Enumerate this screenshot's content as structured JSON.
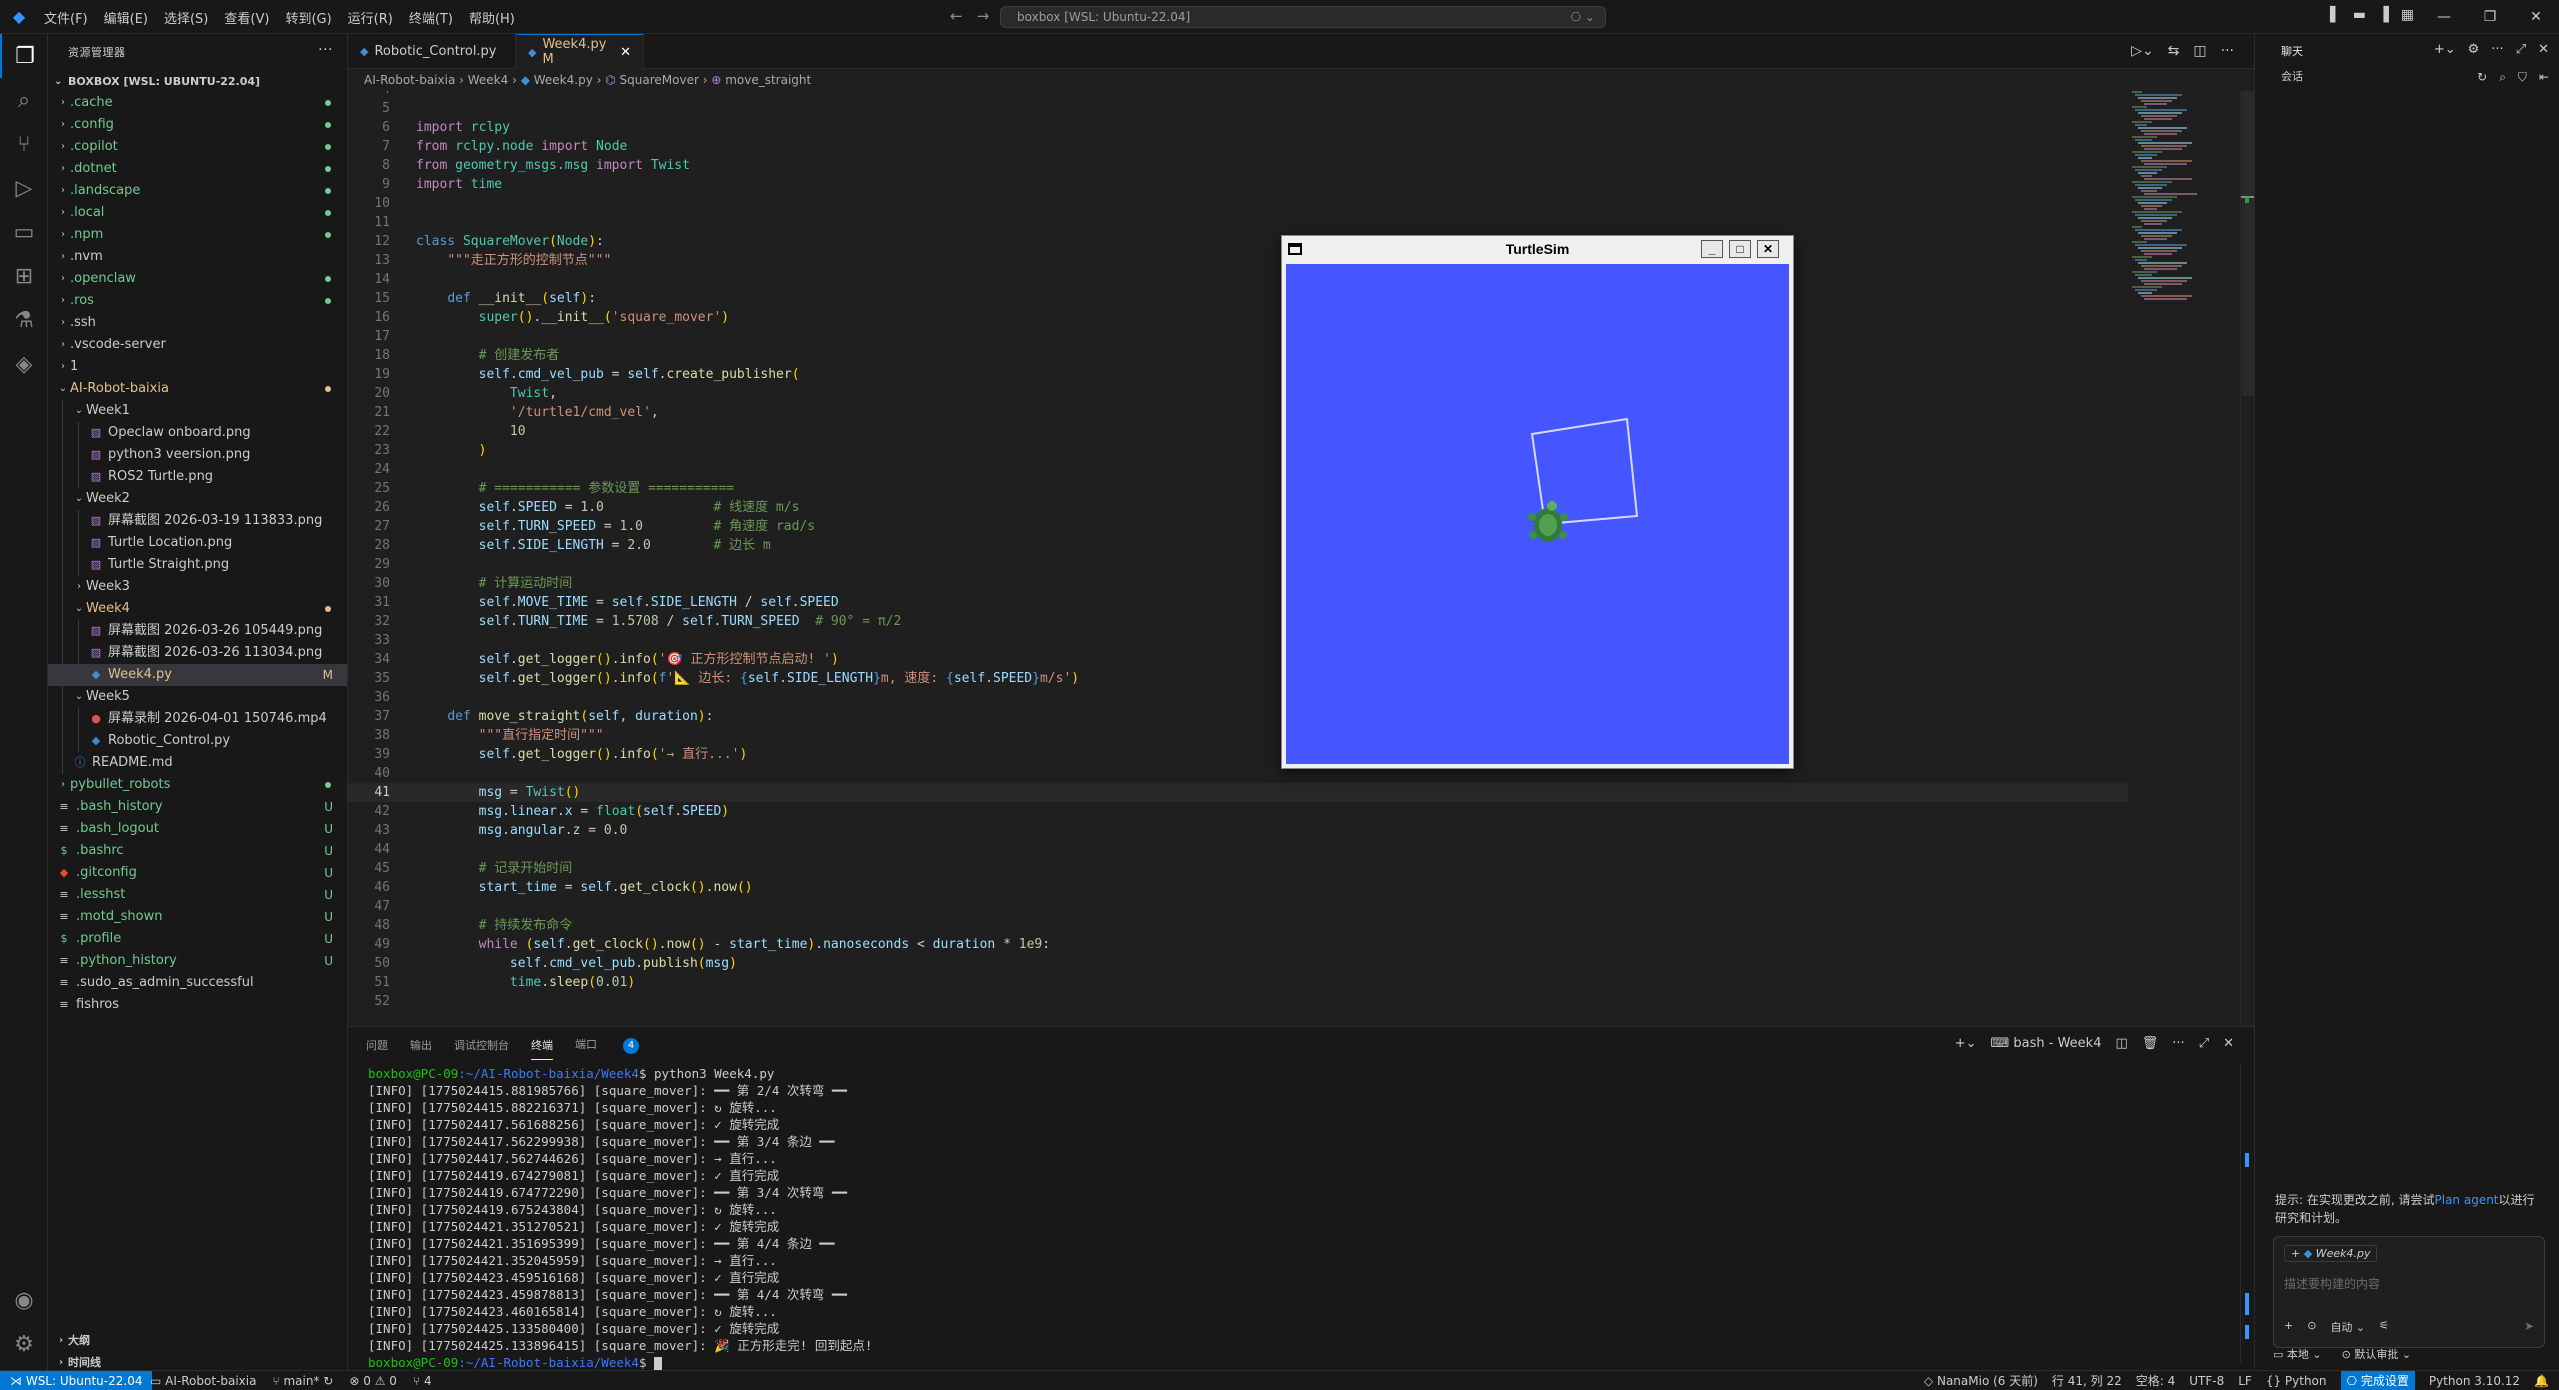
{
  "titlebar": {
    "menu": [
      "文件(F)",
      "编辑(E)",
      "选择(S)",
      "查看(V)",
      "转到(G)",
      "运行(R)",
      "终端(T)",
      "帮助(H)"
    ],
    "command_center": "boxbox [WSL: Ubuntu-22.04]"
  },
  "sidebar": {
    "title": "资源管理器",
    "root": "BOXBOX [WSL: UBUNTU-22.04]",
    "items": [
      {
        "label": ".cache",
        "depth": 0,
        "kind": "folder",
        "open": false,
        "color": "#73c991",
        "dot": true
      },
      {
        "label": ".config",
        "depth": 0,
        "kind": "folder",
        "open": false,
        "color": "#73c991",
        "dot": true
      },
      {
        "label": ".copilot",
        "depth": 0,
        "kind": "folder",
        "open": false,
        "color": "#73c991",
        "dot": true
      },
      {
        "label": ".dotnet",
        "depth": 0,
        "kind": "folder",
        "open": false,
        "color": "#73c991",
        "dot": true
      },
      {
        "label": ".landscape",
        "depth": 0,
        "kind": "folder",
        "open": false,
        "color": "#73c991",
        "dot": true
      },
      {
        "label": ".local",
        "depth": 0,
        "kind": "folder",
        "open": false,
        "color": "#73c991",
        "dot": true
      },
      {
        "label": ".npm",
        "depth": 0,
        "kind": "folder",
        "open": false,
        "color": "#73c991",
        "dot": true
      },
      {
        "label": ".nvm",
        "depth": 0,
        "kind": "folder",
        "open": false,
        "color": "#cccccc",
        "dot": false
      },
      {
        "label": ".openclaw",
        "depth": 0,
        "kind": "folder",
        "open": false,
        "color": "#73c991",
        "dot": true
      },
      {
        "label": ".ros",
        "depth": 0,
        "kind": "folder",
        "open": false,
        "color": "#73c991",
        "dot": true
      },
      {
        "label": ".ssh",
        "depth": 0,
        "kind": "folder",
        "open": false,
        "color": "#cccccc",
        "dot": false
      },
      {
        "label": ".vscode-server",
        "depth": 0,
        "kind": "folder",
        "open": false,
        "color": "#cccccc",
        "dot": false
      },
      {
        "label": "1",
        "depth": 0,
        "kind": "folder",
        "open": false,
        "color": "#cccccc",
        "dot": false
      },
      {
        "label": "AI-Robot-baixia",
        "depth": 0,
        "kind": "folder",
        "open": true,
        "color": "#e2c08d",
        "dot": true,
        "dotcolor": "#e2c08d"
      },
      {
        "label": "Week1",
        "depth": 1,
        "kind": "folder",
        "open": true,
        "color": "#cccccc",
        "dot": false
      },
      {
        "label": "Opeclaw onboard.png",
        "depth": 2,
        "kind": "image",
        "color": "#cccccc",
        "dot": false
      },
      {
        "label": "python3 veersion.png",
        "depth": 2,
        "kind": "image",
        "color": "#cccccc",
        "dot": false
      },
      {
        "label": "ROS2 Turtle.png",
        "depth": 2,
        "kind": "image",
        "color": "#cccccc",
        "dot": false
      },
      {
        "label": "Week2",
        "depth": 1,
        "kind": "folder",
        "open": true,
        "color": "#cccccc",
        "dot": false
      },
      {
        "label": "屏幕截图 2026-03-19 113833.png",
        "depth": 2,
        "kind": "image",
        "color": "#cccccc",
        "dot": false
      },
      {
        "label": "Turtle Location.png",
        "depth": 2,
        "kind": "image",
        "color": "#cccccc",
        "dot": false
      },
      {
        "label": "Turtle Straight.png",
        "depth": 2,
        "kind": "image",
        "color": "#cccccc",
        "dot": false
      },
      {
        "label": "Week3",
        "depth": 1,
        "kind": "folder",
        "open": false,
        "color": "#cccccc",
        "dot": false
      },
      {
        "label": "Week4",
        "depth": 1,
        "kind": "folder",
        "open": true,
        "color": "#e2c08d",
        "dot": true,
        "dotcolor": "#e2c08d"
      },
      {
        "label": "屏幕截图 2026-03-26 105449.png",
        "depth": 2,
        "kind": "image",
        "color": "#cccccc",
        "dot": false
      },
      {
        "label": "屏幕截图 2026-03-26 113034.png",
        "depth": 2,
        "kind": "image",
        "color": "#cccccc",
        "dot": false
      },
      {
        "label": "Week4.py",
        "depth": 2,
        "kind": "python",
        "color": "#e2c08d",
        "badge": "M",
        "selected": true
      },
      {
        "label": "Week5",
        "depth": 1,
        "kind": "folder",
        "open": true,
        "color": "#cccccc",
        "dot": false
      },
      {
        "label": "屏幕录制 2026-04-01 150746.mp4",
        "depth": 2,
        "kind": "video",
        "color": "#cccccc",
        "dot": false
      },
      {
        "label": "Robotic_Control.py",
        "depth": 2,
        "kind": "python",
        "color": "#cccccc",
        "dot": false
      },
      {
        "label": "README.md",
        "depth": 1,
        "kind": "info",
        "color": "#cccccc",
        "dot": false
      },
      {
        "label": "pybullet_robots",
        "depth": 0,
        "kind": "folder",
        "open": false,
        "color": "#73c991",
        "dot": true
      },
      {
        "label": ".bash_history",
        "depth": 0,
        "kind": "file",
        "color": "#73c991",
        "badge": "U"
      },
      {
        "label": ".bash_logout",
        "depth": 0,
        "kind": "file",
        "color": "#73c991",
        "badge": "U"
      },
      {
        "label": ".bashrc",
        "depth": 0,
        "kind": "dollar",
        "color": "#73c991",
        "badge": "U"
      },
      {
        "label": ".gitconfig",
        "depth": 0,
        "kind": "git",
        "color": "#73c991",
        "badge": "U"
      },
      {
        "label": ".lesshst",
        "depth": 0,
        "kind": "file",
        "color": "#73c991",
        "badge": "U"
      },
      {
        "label": ".motd_shown",
        "depth": 0,
        "kind": "file",
        "color": "#73c991",
        "badge": "U"
      },
      {
        "label": ".profile",
        "depth": 0,
        "kind": "dollar",
        "color": "#73c991",
        "badge": "U"
      },
      {
        "label": ".python_history",
        "depth": 0,
        "kind": "file",
        "color": "#73c991",
        "badge": "U"
      },
      {
        "label": ".sudo_as_admin_successful",
        "depth": 0,
        "kind": "file",
        "color": "#cccccc"
      },
      {
        "label": "fishros",
        "depth": 0,
        "kind": "file",
        "color": "#cccccc"
      }
    ],
    "outline": "大纲",
    "timeline": "时间线"
  },
  "tabs": [
    {
      "label": "Robotic_Control.py",
      "active": false
    },
    {
      "label": "Week4.py M",
      "active": true
    }
  ],
  "breadcrumb": [
    "AI-Robot-baixia",
    "Week4",
    "Week4.py",
    "SquareMover",
    "move_straight"
  ],
  "code": [
    {
      "n": "4",
      "html": "<span class='str'>\"\"\"</span>"
    },
    {
      "n": "5",
      "html": ""
    },
    {
      "n": "6",
      "html": "<span class='kw'>import</span> <span class='cls'>rclpy</span>"
    },
    {
      "n": "7",
      "html": "<span class='kw'>from</span> <span class='cls'>rclpy.node</span> <span class='kw'>import</span> <span class='cls'>Node</span>"
    },
    {
      "n": "8",
      "html": "<span class='kw'>from</span> <span class='cls'>geometry_msgs.msg</span> <span class='kw'>import</span> <span class='cls'>Twist</span>"
    },
    {
      "n": "9",
      "html": "<span class='kw'>import</span> <span class='cls'>time</span>"
    },
    {
      "n": "10",
      "html": ""
    },
    {
      "n": "11",
      "html": ""
    },
    {
      "n": "12",
      "html": "<span class='kw2'>class</span> <span class='cls'>SquareMover</span><span class='brace'>(</span><span class='cls'>Node</span><span class='brace'>)</span>:"
    },
    {
      "n": "13",
      "html": "    <span class='str'>\"\"\"走正方形的控制节点\"\"\"</span>"
    },
    {
      "n": "14",
      "html": ""
    },
    {
      "n": "15",
      "html": "    <span class='kw2'>def</span> <span class='fn'>__init__</span><span class='brace'>(</span><span class='self'>self</span><span class='brace'>)</span>:"
    },
    {
      "n": "16",
      "html": "        <span class='cls'>super</span><span class='brace'>()</span>.<span class='fn'>__init__</span><span class='brace'>(</span><span class='str'>'square_mover'</span><span class='brace'>)</span>"
    },
    {
      "n": "17",
      "html": ""
    },
    {
      "n": "18",
      "html": "        <span class='cm'># 创建发布者</span>"
    },
    {
      "n": "19",
      "html": "        <span class='self'>self</span>.<span class='var'>cmd_vel_pub</span> = <span class='self'>self</span>.<span class='fn'>create_publisher</span><span class='brace'>(</span>"
    },
    {
      "n": "20",
      "html": "            <span class='cls'>Twist</span>,"
    },
    {
      "n": "21",
      "html": "            <span class='str'>'/turtle1/cmd_vel'</span>,"
    },
    {
      "n": "22",
      "html": "            <span class='num'>10</span>"
    },
    {
      "n": "23",
      "html": "        <span class='brace'>)</span>"
    },
    {
      "n": "24",
      "html": ""
    },
    {
      "n": "25",
      "html": "        <span class='cm'># =========== 参数设置 ===========</span>"
    },
    {
      "n": "26",
      "html": "        <span class='self'>self</span>.<span class='var'>SPEED</span> = <span class='num'>1.0</span>              <span class='cm'># 线速度 m/s</span>"
    },
    {
      "n": "27",
      "html": "        <span class='self'>self</span>.<span class='var'>TURN_SPEED</span> = <span class='num'>1.0</span>         <span class='cm'># 角速度 rad/s</span>"
    },
    {
      "n": "28",
      "html": "        <span class='self'>self</span>.<span class='var'>SIDE_LENGTH</span> = <span class='num'>2.0</span>        <span class='cm'># 边长 m</span>"
    },
    {
      "n": "29",
      "html": ""
    },
    {
      "n": "30",
      "html": "        <span class='cm'># 计算运动时间</span>"
    },
    {
      "n": "31",
      "html": "        <span class='self'>self</span>.<span class='var'>MOVE_TIME</span> = <span class='self'>self</span>.<span class='var'>SIDE_LENGTH</span> / <span class='self'>self</span>.<span class='var'>SPEED</span>"
    },
    {
      "n": "32",
      "html": "        <span class='self'>self</span>.<span class='var'>TURN_TIME</span> = <span class='num'>1.5708</span> / <span class='self'>self</span>.<span class='var'>TURN_SPEED</span>  <span class='cm'># 90° = π/2</span>"
    },
    {
      "n": "33",
      "html": ""
    },
    {
      "n": "34",
      "html": "        <span class='self'>self</span>.<span class='fn'>get_logger</span><span class='brace'>()</span>.<span class='fn'>info</span><span class='brace'>(</span><span class='str'>'🎯 正方形控制节点启动! '</span><span class='brace'>)</span>"
    },
    {
      "n": "35",
      "html": "        <span class='self'>self</span>.<span class='fn'>get_logger</span><span class='brace'>()</span>.<span class='fn'>info</span><span class='brace'>(</span><span class='kw2'>f</span><span class='str'>'📐 边长: </span><span class='kw2'>{</span><span class='self'>self</span>.<span class='var'>SIDE_LENGTH</span><span class='kw2'>}</span><span class='str'>m, 速度: </span><span class='kw2'>{</span><span class='self'>self</span>.<span class='var'>SPEED</span><span class='kw2'>}</span><span class='str'>m/s'</span><span class='brace'>)</span>"
    },
    {
      "n": "36",
      "html": ""
    },
    {
      "n": "37",
      "html": "    <span class='kw2'>def</span> <span class='fn'>move_straight</span><span class='brace'>(</span><span class='self'>self</span>, <span class='var'>duration</span><span class='brace'>)</span>:"
    },
    {
      "n": "38",
      "html": "        <span class='str'>\"\"\"直行指定时间\"\"\"</span>"
    },
    {
      "n": "39",
      "html": "        <span class='self'>self</span>.<span class='fn'>get_logger</span><span class='brace'>()</span>.<span class='fn'>info</span><span class='brace'>(</span><span class='str'>'→ 直行...'</span><span class='brace'>)</span>"
    },
    {
      "n": "40",
      "html": ""
    },
    {
      "n": "41",
      "html": "        <span class='var'>msg</span> = <span class='cls'>Twist</span><span class='brace'>()</span>",
      "current": true
    },
    {
      "n": "42",
      "html": "        <span class='var'>msg</span>.<span class='var'>linear</span>.<span class='var'>x</span> = <span class='cls'>float</span><span class='brace'>(</span><span class='self'>self</span>.<span class='var'>SPEED</span><span class='brace'>)</span>"
    },
    {
      "n": "43",
      "html": "        <span class='var'>msg</span>.<span class='var'>angular</span>.<span class='var'>z</span> = <span class='num'>0.0</span>"
    },
    {
      "n": "44",
      "html": ""
    },
    {
      "n": "45",
      "html": "        <span class='cm'># 记录开始时间</span>"
    },
    {
      "n": "46",
      "html": "        <span class='var'>start_time</span> = <span class='self'>self</span>.<span class='fn'>get_clock</span><span class='brace'>()</span>.<span class='fn'>now</span><span class='brace'>()</span>"
    },
    {
      "n": "47",
      "html": ""
    },
    {
      "n": "48",
      "html": "        <span class='cm'># 持续发布命令</span>"
    },
    {
      "n": "49",
      "html": "        <span class='kw'>while</span> <span class='brace'>(</span><span class='self'>self</span>.<span class='fn'>get_clock</span><span class='brace'>()</span>.<span class='fn'>now</span><span class='brace'>()</span> - <span class='var'>start_time</span><span class='brace'>)</span>.<span class='var'>nanoseconds</span> &lt; <span class='var'>duration</span> * <span class='num'>1e9</span>:"
    },
    {
      "n": "50",
      "html": "            <span class='self'>self</span>.<span class='var'>cmd_vel_pub</span>.<span class='fn'>publish</span><span class='brace'>(</span><span class='var'>msg</span><span class='brace'>)</span>"
    },
    {
      "n": "51",
      "html": "            <span class='cls'>time</span>.<span class='fn'>sleep</span><span class='brace'>(</span><span class='num'>0.01</span><span class='brace'>)</span>"
    },
    {
      "n": "52",
      "html": ""
    }
  ],
  "panel": {
    "tabs": [
      "问题",
      "输出",
      "调试控制台",
      "终端",
      "端口"
    ],
    "ports_count": "4",
    "terminal_name": "bash - Week4",
    "prompt_user": "boxbox@PC-09",
    "prompt_path": ":~/AI-Robot-baixia/Week4",
    "command": "$ python3 Week4.py",
    "lines": [
      "[INFO] [1775024415.881985766] [square_mover]: ━━ 第 2/4 次转弯 ━━",
      "[INFO] [1775024415.882216371] [square_mover]: ↻ 旋转...",
      "[INFO] [1775024417.561688256] [square_mover]: ✓ 旋转完成",
      "[INFO] [1775024417.562299938] [square_mover]: ━━ 第 3/4 条边 ━━",
      "[INFO] [1775024417.562744626] [square_mover]: → 直行...",
      "[INFO] [1775024419.674279081] [square_mover]: ✓ 直行完成",
      "[INFO] [1775024419.674772290] [square_mover]: ━━ 第 3/4 次转弯 ━━",
      "[INFO] [1775024419.675243804] [square_mover]: ↻ 旋转...",
      "[INFO] [1775024421.351270521] [square_mover]: ✓ 旋转完成",
      "[INFO] [1775024421.351695399] [square_mover]: ━━ 第 4/4 条边 ━━",
      "[INFO] [1775024421.352045959] [square_mover]: → 直行...",
      "[INFO] [1775024423.459516168] [square_mover]: ✓ 直行完成",
      "[INFO] [1775024423.459878813] [square_mover]: ━━ 第 4/4 次转弯 ━━",
      "[INFO] [1775024423.460165814] [square_mover]: ↻ 旋转...",
      "[INFO] [1775024425.133580400] [square_mover]: ✓ 旋转完成",
      "[INFO] [1775024425.133896415] [square_mover]: 🎉 正方形走完! 回到起点!"
    ],
    "last_prompt_suffix": "$ "
  },
  "turtlesim": {
    "title": "TurtleSim",
    "bg_color": "#4556ff",
    "minimize": "_",
    "maximize": "□",
    "close": "✕"
  },
  "chat": {
    "title": "聊天",
    "subtitle": "会话",
    "tip_prefix": "提示: 在实现更改之前, 请尝试",
    "tip_link": "Plan agent",
    "tip_suffix": "以进行研究和计划。",
    "context_chip": "Week4.py",
    "placeholder": "描述要构建的内容",
    "mode": "自动",
    "footer_local": "本地",
    "footer_approve": "默认审批"
  },
  "status": {
    "remote": "WSL: Ubuntu-22.04",
    "folder": "AI-Robot-baixia",
    "branch": "main*",
    "errors": "0",
    "warnings": "0",
    "ports": "4",
    "user": "NanaMio (6 天前)",
    "position": "行 41, 列 22",
    "spaces": "空格: 4",
    "encoding": "UTF-8",
    "eol": "LF",
    "lang": "Python",
    "done": "完成设置",
    "python": "Python 3.10.12"
  }
}
